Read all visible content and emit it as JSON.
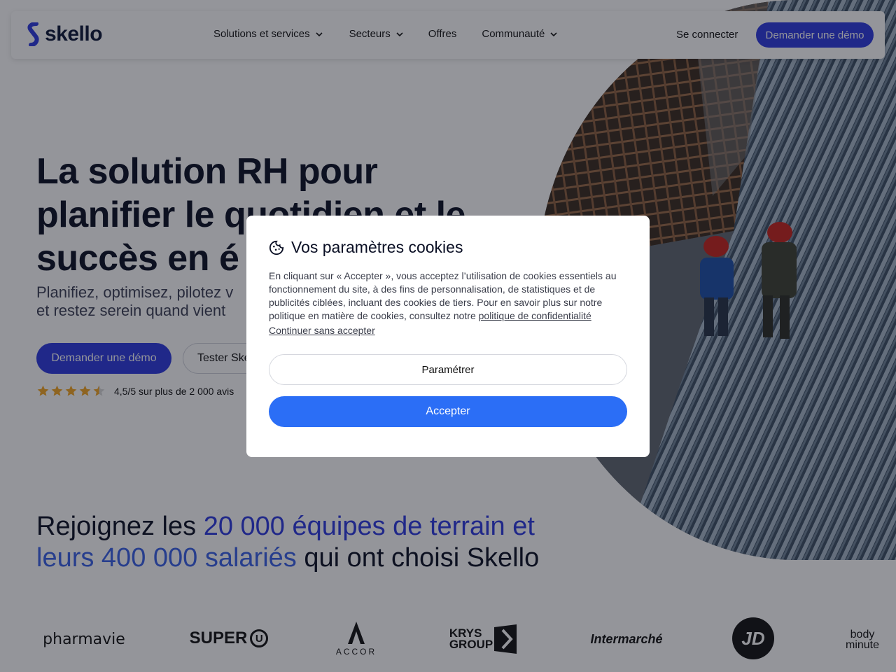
{
  "nav": {
    "logo_text": "skello",
    "links": [
      {
        "label": "Solutions et services",
        "has_dropdown": true
      },
      {
        "label": "Secteurs",
        "has_dropdown": true
      },
      {
        "label": "Offres",
        "has_dropdown": false
      },
      {
        "label": "Communauté",
        "has_dropdown": true
      }
    ],
    "login_label": "Se connecter",
    "cta_label": "Demander une démo"
  },
  "hero": {
    "title_line1": "La solution RH pour",
    "title_line2": "planifier le quotidien et le",
    "title_line3": "succès en é",
    "subtitle_line1": "Planifiez, optimisez, pilotez v",
    "subtitle_line2": "et restez serein quand vient",
    "primary_button": "Demander une démo",
    "secondary_button": "Tester Ske",
    "rating_text": "4,5/5 sur plus de 2 000 avis",
    "rating_value": 4.5,
    "rating_max": 5
  },
  "join": {
    "part1": "Rejoignez les ",
    "highlight1": "20 000 équipes de terrain et",
    "highlight2": "leurs 400 000 salariés",
    "part2": " qui ont choisi Skello"
  },
  "logos": {
    "pharmavie": "pharmavie",
    "superu": "SUPER",
    "superu_u": "U",
    "accor": "ACCOR",
    "krys_line1": "KRYS",
    "krys_line2": "GROUP",
    "intermarche": "Intermarché",
    "jd": "JD",
    "bodyminute_line1": "body",
    "bodyminute_line2": "minute"
  },
  "cookie_modal": {
    "title": "Vos paramètres cookies",
    "body": "En cliquant sur « Accepter », vous acceptez l’utilisation de cookies essentiels au fonctionnement du site, à des fins de personnalisation, de statistiques et de publicités ciblées, incluant des cookies de tiers. Pour en savoir plus sur notre politique en matière de cookies, consultez notre ",
    "privacy_link": "politique de confidentialité",
    "continue_link": "Continuer sans accepter",
    "settings_button": "Paramétrer",
    "accept_button": "Accepter"
  },
  "colors": {
    "brand_blue": "#2d3ae0",
    "accept_blue": "#2b6ef6",
    "star": "#f5a623"
  }
}
